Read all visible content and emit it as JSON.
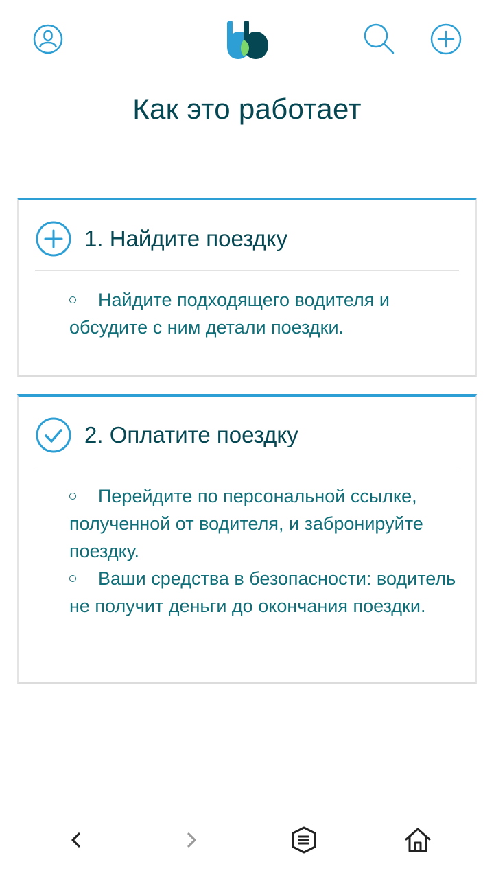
{
  "header": {
    "profile_icon": "user-circle-icon",
    "logo": "blablacar-logo",
    "search_icon": "search-icon",
    "add_icon": "plus-circle-icon"
  },
  "page": {
    "title": "Как это работает"
  },
  "cards": [
    {
      "title": "1. Найдите поездку",
      "icon": "plus-circle-icon",
      "bullets": [
        "Найдите подходящего водителя и обсудите с ним детали поездки."
      ]
    },
    {
      "title": "2. Оплатите поездку",
      "icon": "check-circle-icon",
      "bullets": [
        "Перейдите по персональной ссылке, полученной от водителя, и забронируйте поездку.",
        "Ваши средства в безопасности: водитель не получит деньги до окончания поездки."
      ]
    }
  ],
  "navbar": {
    "back_icon": "chevron-left-icon",
    "forward_icon": "chevron-right-icon",
    "menu_icon": "menu-icon",
    "home_icon": "home-icon"
  },
  "colors": {
    "accent": "#2d9fd4",
    "text_dark": "#054752",
    "text_body": "#0f6e78",
    "logo_green": "#7cd86b"
  }
}
